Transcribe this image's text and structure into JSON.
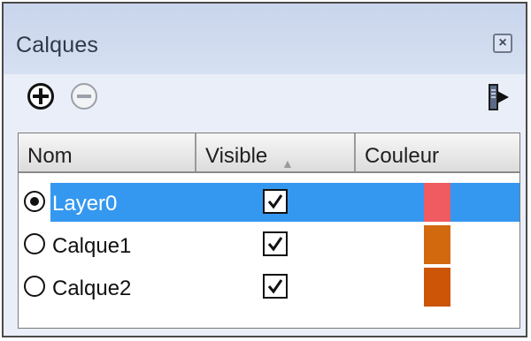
{
  "panel": {
    "title": "Calques"
  },
  "table": {
    "columns": [
      "Nom",
      "Visible",
      "Couleur"
    ],
    "sort_arrow": "▲",
    "rows": [
      {
        "name": "Layer0",
        "active": true,
        "visible": true,
        "color": "#ef5b60",
        "selected": true
      },
      {
        "name": "Calque1",
        "active": false,
        "visible": true,
        "color": "#d2690e",
        "selected": false
      },
      {
        "name": "Calque2",
        "active": false,
        "visible": true,
        "color": "#cc5508",
        "selected": false
      }
    ]
  },
  "icons": {
    "close": "close-icon",
    "add": "plus-circle-icon",
    "remove": "minus-circle-icon",
    "details": "details-arrow-icon"
  },
  "colors": {
    "titlebar": "#c9d5ec",
    "selection": "#3598f0"
  }
}
